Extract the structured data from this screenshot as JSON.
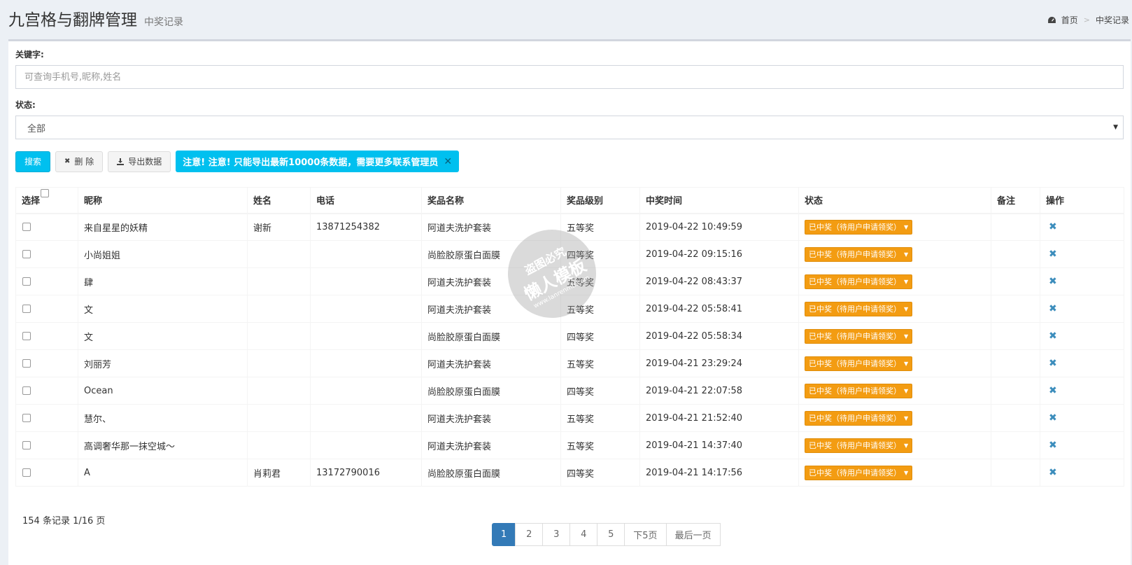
{
  "header": {
    "title": "九宫格与翻牌管理",
    "subtitle": "中奖记录",
    "breadcrumb": {
      "home": "首页",
      "current": "中奖记录",
      "separator": ">"
    }
  },
  "filters": {
    "keyword_label": "关键字:",
    "keyword_value": "",
    "keyword_placeholder": "可查询手机号,昵称,姓名",
    "status_label": "状态:",
    "status_value": "全部"
  },
  "toolbar": {
    "search_label": "搜索",
    "delete_label": "删 除",
    "export_label": "导出数据",
    "notice": "注意! 注意! 只能导出最新10000条数据，需要更多联系管理员",
    "notice_close": "✕"
  },
  "table": {
    "headers": [
      "选择",
      "昵称",
      "姓名",
      "电话",
      "奖品名称",
      "奖品级别",
      "中奖时间",
      "状态",
      "备注",
      "操作"
    ],
    "rows": [
      {
        "nickname": "来自星星的妖精",
        "name": "谢新",
        "phone": "13871254382",
        "prize": "阿道夫洗护套装",
        "level": "五等奖",
        "time": "2019-04-22 10:49:59",
        "status": "已中奖（待用户申请领奖）",
        "remark": ""
      },
      {
        "nickname": "小尚姐姐",
        "name": "",
        "phone": "",
        "prize": "尚脸胶原蛋白面膜",
        "level": "四等奖",
        "time": "2019-04-22 09:15:16",
        "status": "已中奖（待用户申请领奖）",
        "remark": ""
      },
      {
        "nickname": "肆",
        "name": "",
        "phone": "",
        "prize": "阿道夫洗护套装",
        "level": "五等奖",
        "time": "2019-04-22 08:43:37",
        "status": "已中奖（待用户申请领奖）",
        "remark": ""
      },
      {
        "nickname": "文",
        "name": "",
        "phone": "",
        "prize": "阿道夫洗护套装",
        "level": "五等奖",
        "time": "2019-04-22 05:58:41",
        "status": "已中奖（待用户申请领奖）",
        "remark": ""
      },
      {
        "nickname": "文",
        "name": "",
        "phone": "",
        "prize": "尚脸胶原蛋白面膜",
        "level": "四等奖",
        "time": "2019-04-22 05:58:34",
        "status": "已中奖（待用户申请领奖）",
        "remark": ""
      },
      {
        "nickname": "刘丽芳",
        "name": "",
        "phone": "",
        "prize": "阿道夫洗护套装",
        "level": "五等奖",
        "time": "2019-04-21 23:29:24",
        "status": "已中奖（待用户申请领奖）",
        "remark": ""
      },
      {
        "nickname": "Ocean",
        "name": "",
        "phone": "",
        "prize": "尚脸胶原蛋白面膜",
        "level": "四等奖",
        "time": "2019-04-21 22:07:58",
        "status": "已中奖（待用户申请领奖）",
        "remark": ""
      },
      {
        "nickname": "慧尔、",
        "name": "",
        "phone": "",
        "prize": "阿道夫洗护套装",
        "level": "五等奖",
        "time": "2019-04-21 21:52:40",
        "status": "已中奖（待用户申请领奖）",
        "remark": ""
      },
      {
        "nickname": "高调奢华那一抹空城～",
        "name": "",
        "phone": "",
        "prize": "阿道夫洗护套装",
        "level": "五等奖",
        "time": "2019-04-21 14:37:40",
        "status": "已中奖（待用户申请领奖）",
        "remark": ""
      },
      {
        "nickname": "A",
        "name": "肖莉君",
        "phone": "13172790016",
        "prize": "尚脸胶原蛋白面膜",
        "level": "四等奖",
        "time": "2019-04-21 14:17:56",
        "status": "已中奖（待用户申请领奖）",
        "remark": ""
      }
    ]
  },
  "footer": {
    "summary": "154 条记录 1/16 页",
    "pages": [
      "1",
      "2",
      "3",
      "4",
      "5",
      "下5页",
      "最后一页"
    ],
    "active_page": "1"
  },
  "watermark": {
    "line1": "盗图必究",
    "line2": "懒人模板",
    "line3": "www.lanrenmb.com"
  },
  "colors": {
    "primary": "#00c0ef",
    "warning": "#f39c12",
    "link": "#3c8dbc",
    "page_active": "#337ab7"
  },
  "icons": {
    "home": "dashboard-icon",
    "delete": "times-icon",
    "export": "download-icon",
    "dropdown": "caret-down-icon"
  }
}
